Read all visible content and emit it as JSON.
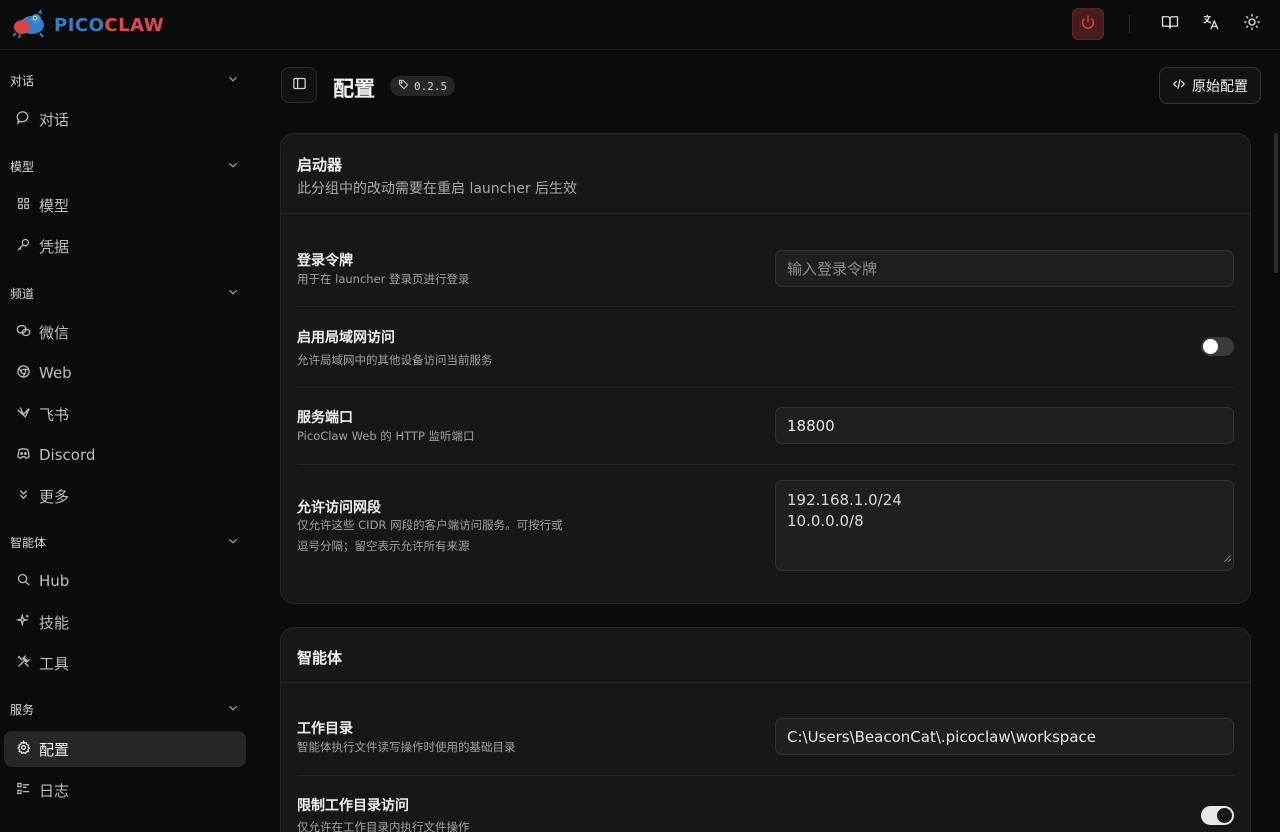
{
  "app": {
    "logo_pico": "PICO",
    "logo_claw": "CLAW"
  },
  "topbar": {
    "icons": [
      "power-icon",
      "book-icon",
      "translate-icon",
      "sun-icon"
    ],
    "colors": {
      "power_bg": "#4a1a1c",
      "power_icon": "#e04848"
    }
  },
  "sidebar": {
    "groups": {
      "chat": "对话",
      "model": "模型",
      "channel": "频道",
      "agent": "智能体",
      "service": "服务"
    },
    "items": {
      "chat": "对话",
      "model": "模型",
      "credential": "凭据",
      "wechat": "微信",
      "web": "Web",
      "feishu": "飞书",
      "discord": "Discord",
      "more": "更多",
      "hub": "Hub",
      "skills": "技能",
      "tools": "工具",
      "config": "配置",
      "logs": "日志"
    },
    "active": "config"
  },
  "header": {
    "title": "配置",
    "version": "0.2.5",
    "raw_config_label": "原始配置"
  },
  "launcher_card": {
    "title": "启动器",
    "subtitle": "此分组中的改动需要在重启 launcher 后生效",
    "token": {
      "label": "登录令牌",
      "desc": "用于在 launcher 登录页进行登录",
      "placeholder": "输入登录令牌"
    },
    "lan": {
      "label": "启用局域网访问",
      "desc": "允许局域网中的其他设备访问当前服务",
      "enabled": false
    },
    "port": {
      "label": "服务端口",
      "desc": "PicoClaw Web 的 HTTP 监听端口",
      "value": "18800"
    },
    "cidr": {
      "label": "允许访问网段",
      "desc_line1": "仅允许这些 CIDR 网段的客户端访问服务。可按行或",
      "desc_line2": "逗号分隔；留空表示允许所有来源",
      "value_line1": "192.168.1.0/24",
      "value_line2": "10.0.0.0/8"
    }
  },
  "agent_card": {
    "title": "智能体",
    "workdir": {
      "label": "工作目录",
      "desc": "智能体执行文件读写操作时使用的基础目录",
      "value": "C:\\Users\\BeaconCat\\.picoclaw\\workspace"
    },
    "restrict": {
      "label": "限制工作目录访问",
      "desc": "仅允许在工作目录内执行文件操作",
      "enabled": true
    }
  }
}
